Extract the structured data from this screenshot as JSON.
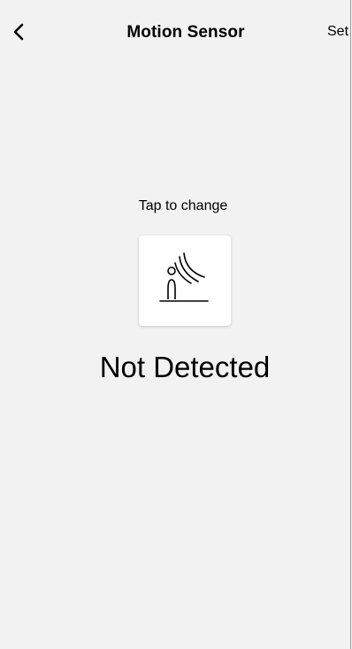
{
  "header": {
    "back_icon": "chevron-left-icon",
    "title": "Motion Sensor",
    "action_label": "Set"
  },
  "sensor": {
    "hint": "Tap to change",
    "icon": "motion-sensor-person-icon",
    "status": "Not Detected"
  }
}
